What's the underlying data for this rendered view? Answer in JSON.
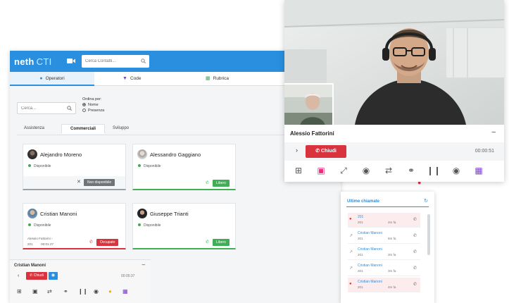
{
  "app": {
    "logo": "neth",
    "logo_suffix": "CTI",
    "search_placeholder": "Cerca Contatti...",
    "tabs": [
      {
        "label": "Operatori",
        "icon": "user-icon"
      },
      {
        "label": "Code",
        "icon": "queue-icon"
      },
      {
        "label": "Rubrica",
        "icon": "phonebook-icon"
      }
    ],
    "filter_placeholder": "Cerca...",
    "order_label": "Ordina per:",
    "order_options": [
      {
        "label": "Nome",
        "selected": true
      },
      {
        "label": "Presenza",
        "selected": false
      }
    ],
    "groups": [
      "Assistenza",
      "Commerciali",
      "Sviluppo"
    ],
    "active_group": "Commerciali",
    "operators": [
      {
        "name": "Alejandro Moreno",
        "status": "Disponibile",
        "action": "Non disponibile"
      },
      {
        "name": "Alessandro Gaggiano",
        "status": "Disponibile",
        "action": "Libero"
      },
      {
        "name": "Cristian Manoni",
        "status": "Disponibile",
        "call_with": "Alessio Fattorini",
        "call_number": "201",
        "call_time": "00:01:27",
        "action": "Occupato"
      },
      {
        "name": "Giuseppe Trianti",
        "status": "Disponibile",
        "action": "Libero"
      }
    ],
    "mini_call": {
      "name": "Cristian Manoni",
      "hangup_label": "Chiudi",
      "timer": "00:05:37"
    }
  },
  "recent": {
    "title": "Ultime chiamate",
    "items": [
      {
        "name": "201",
        "number": "201",
        "time": "4m fa",
        "missed": true
      },
      {
        "name": "Cristian Manoni",
        "number": "201",
        "time": "5m fa",
        "missed": false
      },
      {
        "name": "Cristian Manoni",
        "number": "201",
        "time": "3m fa",
        "missed": false
      },
      {
        "name": "Cristian Manoni",
        "number": "201",
        "time": "3m fa",
        "missed": false
      },
      {
        "name": "Cristian Manoni",
        "number": "201",
        "time": "4m fa",
        "missed": true
      }
    ]
  },
  "video_call": {
    "caller": "Alessio Fattorini",
    "hangup_label": "Chiudi",
    "timer": "00:00:51"
  },
  "colors": {
    "primary": "#2a8fde",
    "success": "#3fae55",
    "danger": "#d9343e",
    "accent": "#ec2d7a",
    "purple": "#7b3fd1"
  }
}
